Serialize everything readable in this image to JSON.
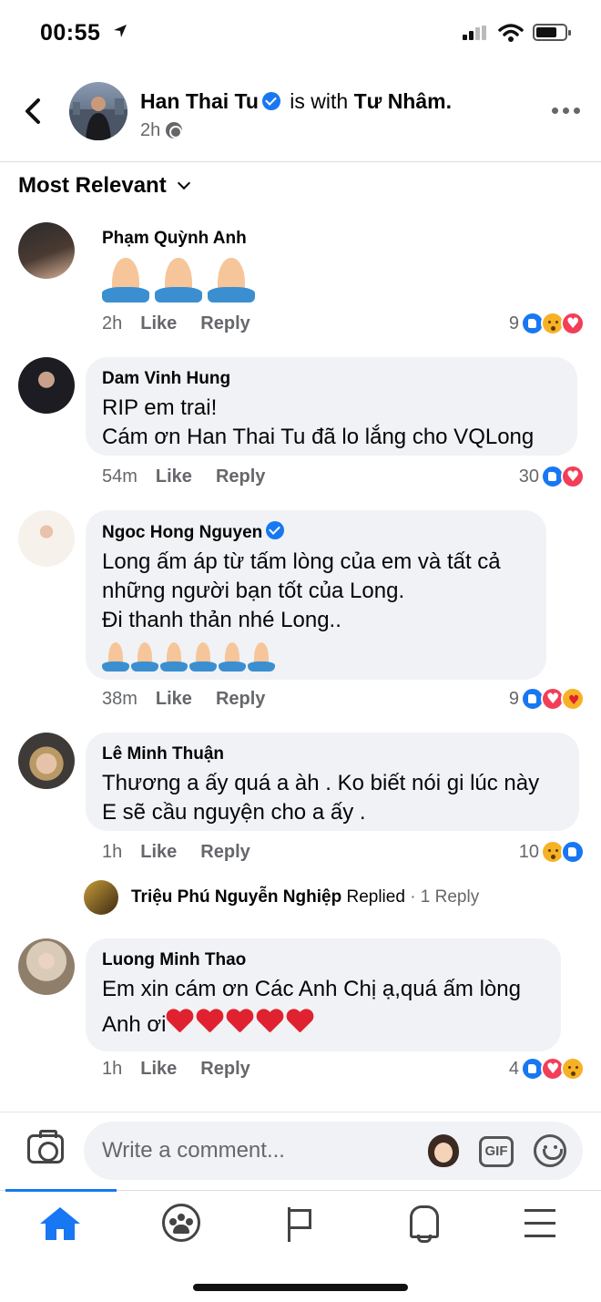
{
  "status_bar": {
    "time": "00:55",
    "icons": [
      "location-arrow-icon",
      "signal-icon",
      "wifi-icon",
      "battery-icon"
    ]
  },
  "post": {
    "author": "Han Thai Tu",
    "with_text": "is with",
    "with_name": "Tư Nhâm.",
    "time": "2h",
    "privacy_icon": "globe-icon"
  },
  "sort": {
    "label": "Most Relevant"
  },
  "comments": [
    {
      "name": "Phạm Quỳnh Anh",
      "time": "2h",
      "like": "Like",
      "reply": "Reply",
      "reaction_count": "9",
      "reactions": [
        "like",
        "sad",
        "love"
      ],
      "emoji": "pray x3"
    },
    {
      "name": "Dam Vinh Hung",
      "lines": [
        "RIP em trai!",
        "Cám ơn Han Thai Tu đã lo lắng cho VQLong"
      ],
      "time": "54m",
      "like": "Like",
      "reply": "Reply",
      "reaction_count": "30",
      "reactions": [
        "like",
        "love"
      ]
    },
    {
      "name": "Ngoc Hong Nguyen",
      "verified": true,
      "lines": [
        "Long ấm áp từ tấm lòng của em và tất cả",
        "những người bạn tốt của Long.",
        "Đi thanh thản nhé Long.."
      ],
      "time": "38m",
      "like": "Like",
      "reply": "Reply",
      "reaction_count": "9",
      "reactions": [
        "like",
        "love",
        "care"
      ],
      "emoji": "pray x6"
    },
    {
      "name": "Lê Minh Thuận",
      "lines": [
        "Thương a ấy quá a àh . Ko biết nói gi lúc này",
        "E sẽ cầu nguyện cho a ấy ."
      ],
      "time": "1h",
      "like": "Like",
      "reply": "Reply",
      "reaction_count": "10",
      "reactions": [
        "sad",
        "like"
      ]
    },
    {
      "name": "Luong Minh Thao",
      "lines": [
        "Em xin cám ơn Các Anh Chị ạ,quá ấm lòng",
        "Anh ơi"
      ],
      "time": "1h",
      "like": "Like",
      "reply": "Reply",
      "reaction_count": "4",
      "reactions": [
        "like",
        "love",
        "sad"
      ],
      "emoji": "heart x5"
    }
  ],
  "reply_summary": {
    "name": "Triệu Phú Nguyễn Nghiệp",
    "action": "Replied",
    "count": "· 1 Reply"
  },
  "composer": {
    "placeholder": "Write a comment...",
    "gif_label": "GIF"
  },
  "tabbar": {
    "tabs": [
      "home-icon",
      "groups-icon",
      "pages-flag-icon",
      "notifications-bell-icon",
      "menu-icon"
    ],
    "active": "home",
    "accent": "#1877f2"
  }
}
